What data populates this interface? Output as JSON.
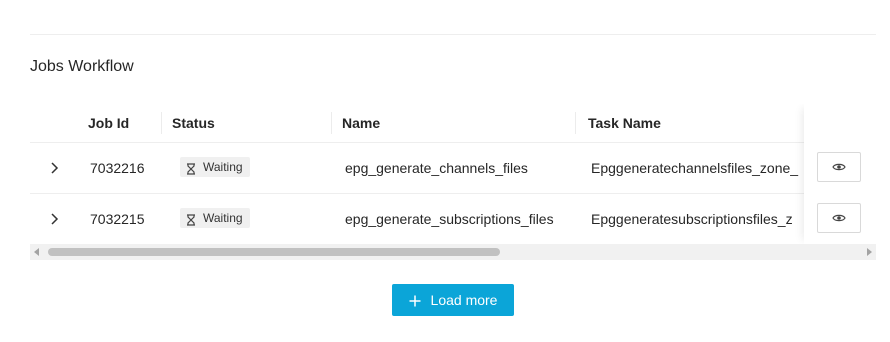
{
  "section": {
    "title": "Jobs Workflow"
  },
  "table": {
    "columns": [
      "Job Id",
      "Status",
      "Name",
      "Task Name"
    ],
    "rows": [
      {
        "job_id": "7032216",
        "status": "Waiting",
        "name": "epg_generate_channels_files",
        "task_name": "Epggeneratechannelsfiles_zone_"
      },
      {
        "job_id": "7032215",
        "status": "Waiting",
        "name": "epg_generate_subscriptions_files",
        "task_name": "Epggeneratesubscriptionsfiles_z"
      }
    ]
  },
  "actions": {
    "load_more_label": "Load more"
  },
  "colors": {
    "accent": "#0ba5d8",
    "badge_bg": "#f0f0f0",
    "divider": "#eeeeee"
  },
  "icons": {
    "expand": "chevron-right-icon",
    "status": "hourglass-icon",
    "view": "eye-icon",
    "load_more": "plus-icon"
  }
}
